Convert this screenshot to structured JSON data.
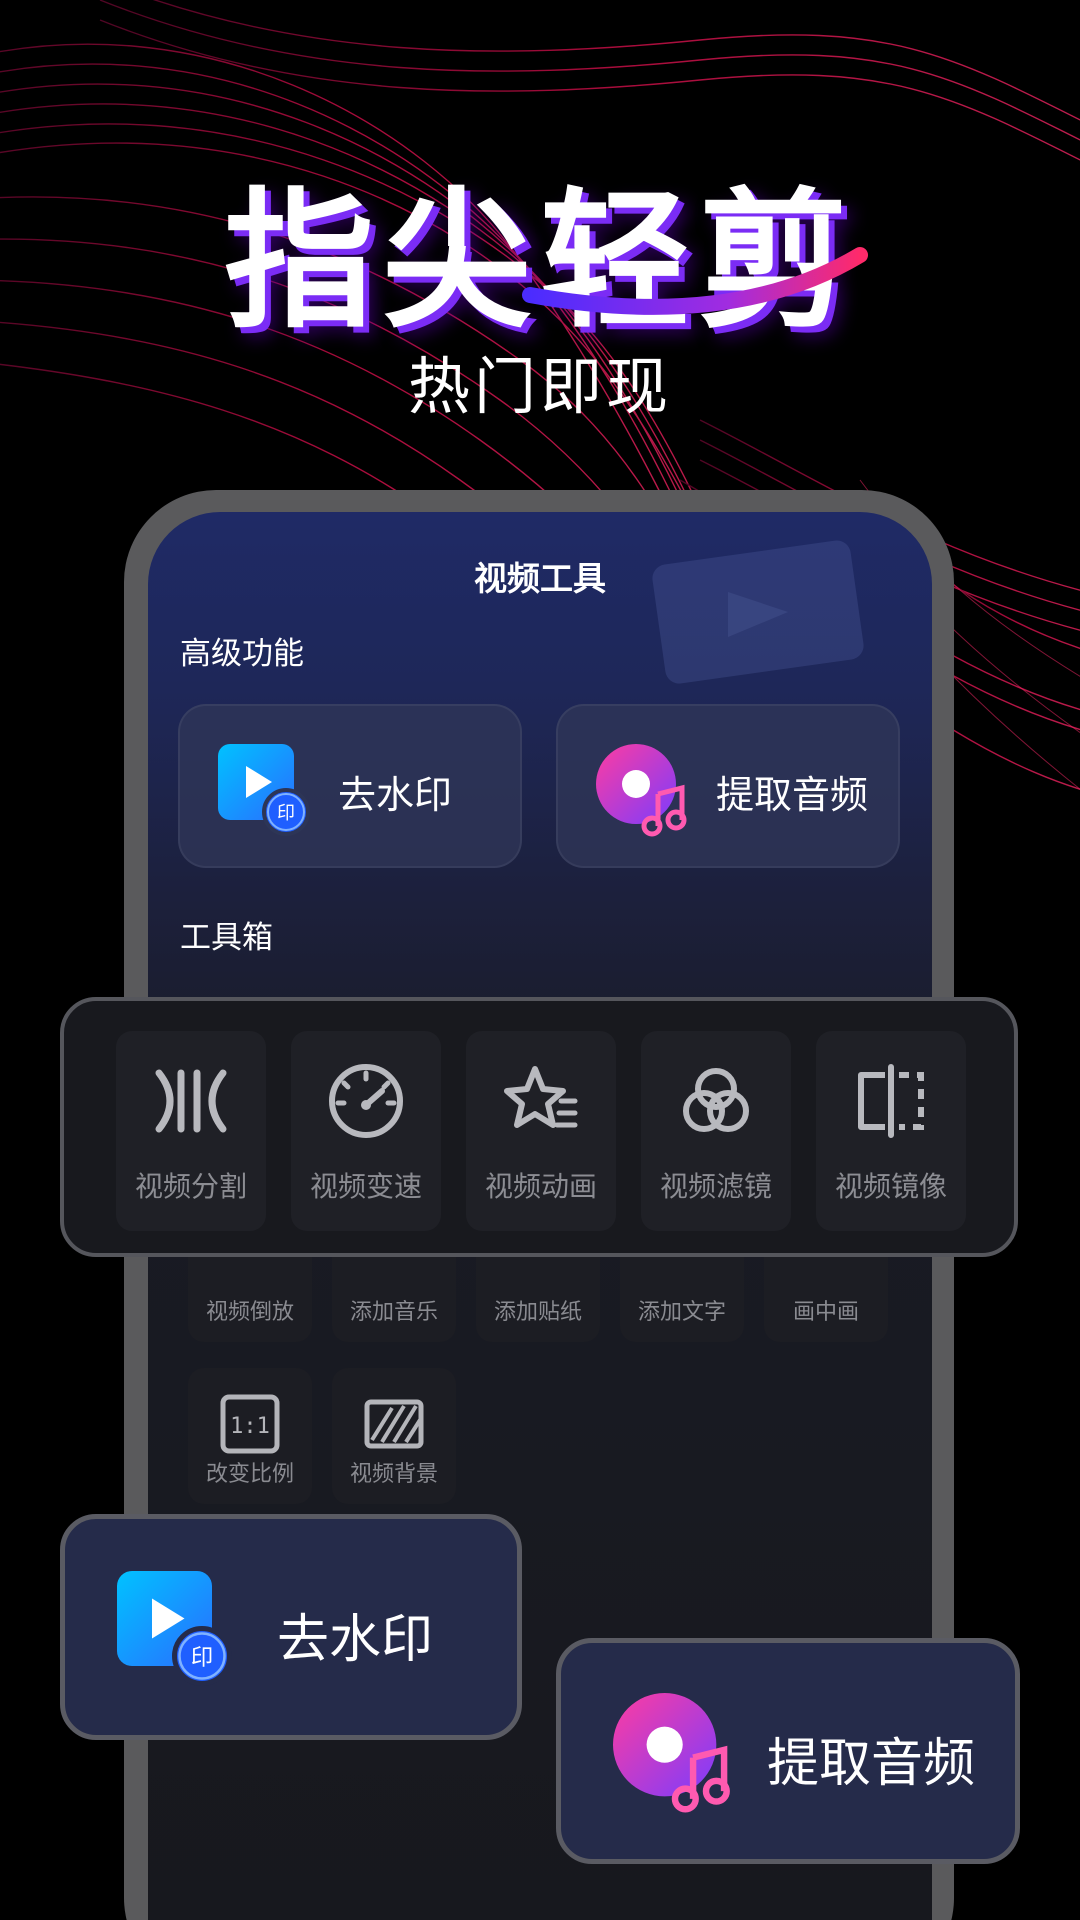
{
  "hero": {
    "title": "指尖轻剪",
    "subtitle": "热门即现"
  },
  "screen": {
    "title": "视频工具",
    "advanced_label": "高级功能",
    "toolbox_label": "工具箱",
    "features": [
      {
        "label": "去水印",
        "icon": "play-stamp-icon"
      },
      {
        "label": "提取音频",
        "icon": "music-disc-icon"
      }
    ],
    "tools_row2": [
      {
        "label": "视频倒放"
      },
      {
        "label": "添加音乐"
      },
      {
        "label": "添加贴纸"
      },
      {
        "label": "添加文字"
      },
      {
        "label": "画中画"
      }
    ],
    "tools_row3": [
      {
        "label": "改变比例",
        "icon": "ratio-icon"
      },
      {
        "label": "视频背景",
        "icon": "background-icon"
      }
    ]
  },
  "toolbox_highlight": [
    {
      "label": "视频分割",
      "icon": "split-icon"
    },
    {
      "label": "视频变速",
      "icon": "speedometer-icon"
    },
    {
      "label": "视频动画",
      "icon": "star-icon"
    },
    {
      "label": "视频滤镜",
      "icon": "filter-icon"
    },
    {
      "label": "视频镜像",
      "icon": "mirror-icon"
    }
  ],
  "floating_cards": {
    "watermark_label": "去水印",
    "audio_label": "提取音频"
  },
  "colors": {
    "accent_purple": "#7b2cf5",
    "ribbon_red": "#e0104f",
    "card_bg": "#252b4a"
  }
}
